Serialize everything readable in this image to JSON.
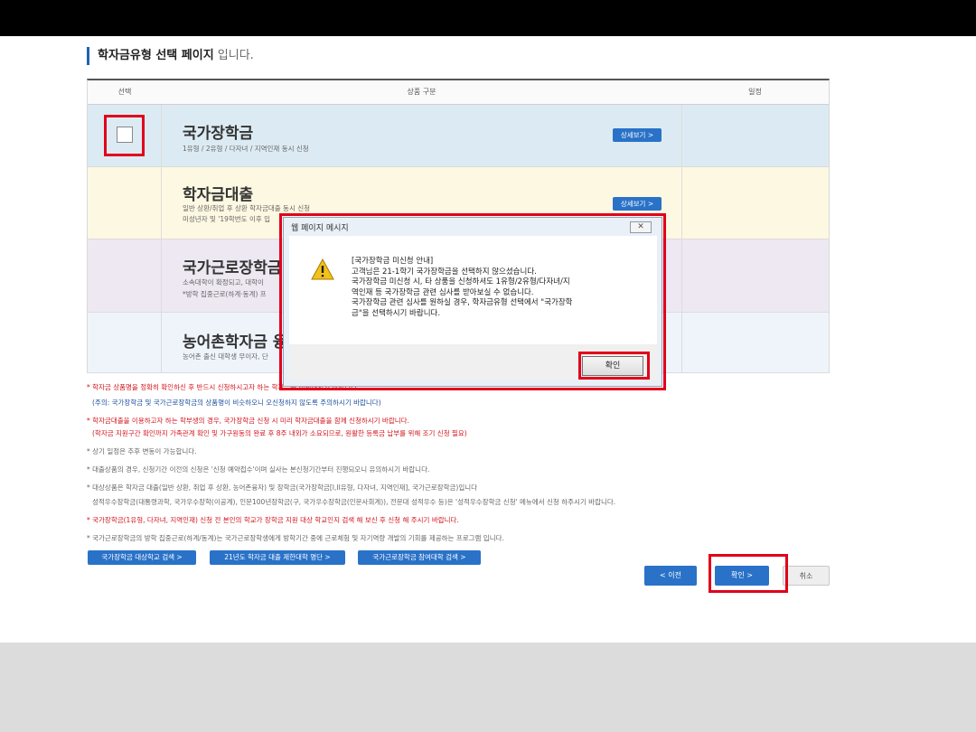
{
  "heading": {
    "bold": "학자금유형 선택 페이지",
    "rest": " 입니다."
  },
  "table": {
    "headers": [
      "선택",
      "상품 구분",
      "일정"
    ],
    "rows": [
      {
        "title": "국가장학금",
        "sub1": "1유형 / 2유형 / 다자녀 / 지역인재 동시 신청",
        "sub2": "",
        "detail": "상세보기 >",
        "bg": "#dcebf3"
      },
      {
        "title": "학자금대출",
        "sub1": "일반 상환/취업 후 상환 학자금대출 동시 신청",
        "sub2": "미성년자 및 '19학번도 이후 입",
        "detail": "상세보기 >",
        "bg": "#fdf8e2"
      },
      {
        "title": "국가근로장학금",
        "sub1": "소속대학이 확정되고, 대학이",
        "sub2": "*방학 집중근로(하계·동계) 프",
        "detail": "",
        "bg": "#ede8f1"
      },
      {
        "title": "농어촌학자금 융",
        "sub1": "농어촌 출신 대학생 무이자, 단",
        "sub2": "",
        "detail": "",
        "bg": "#eef4fa"
      }
    ]
  },
  "notes": {
    "n1": "* 학자금 상품명을 정확히 확인하신 후 반드시 신청하시고자 하는 학자금을 선택하시기 바랍니다.",
    "n1b": "(주의: 국가장학금 및 국가근로장학금의 상품명이 비슷하오니 오신청하지 않도록 주의하시기 바랍니다)",
    "n2": "* 학자금대출을 이용하고자 하는 학부생의 경우, 국가장학금 신청 시 미리 학자금대출을 함께 신청하시기 바랍니다.",
    "n2b": "(학자금 지원구간 확인까지 가족관계 확인 및 가구원동의 완료 후 8주 내외가 소요되므로, 원활한 등록금 납부를 위해 조기 신청 필요)",
    "n3": "* 상기 일정은 추후 변동이 가능합니다.",
    "n4": "* 대출상품의 경우, 신청기간 이전의 신청은 '신청 예약접수'이며 실사는 본신청기간부터 진행되오니 유의하시기 바랍니다.",
    "n5": "* 대상상품은 학자금 대출(일반 상환, 취업 후 상환, 농어촌융자) 및 장학금(국가장학금[I,II유형, 다자녀, 지역인재], 국가근로장학금)입니다",
    "n5b": "성적우수장학금(대통령과학, 국가우수장학(이공계), 인문100년장학금(구, 국가우수장학금(인문사회계)), 전문대 성적우수 등)은 '성적우수장학금 신청' 메뉴에서 신청 하주시기 바랍니다.",
    "n6": "* 국가장학금(1유형, 다자녀, 지역인재) 신청 전 본인의 학교가 장학금 지원 대상 학교인지 검색 해 보신 후 신청 해 주시기 바랍니다.",
    "n7": "* 국가근로장학금의 방학 집중근로(하계/동계)는 국가근로장학생에게 방학기간 중에 근로체험 및 자기역량 개발의 기회를 제공하는 프로그램 입니다."
  },
  "links": [
    "국가장학금 대상학교 검색 >",
    "21년도 학자금 대출 제한대학 명단 >",
    "국가근로장학금 참여대학 검색 >"
  ],
  "nav": {
    "prev": "< 이전",
    "confirm": "확인 >",
    "cancel": "취소"
  },
  "dialog": {
    "title": "웹 페이지 메시지",
    "close": "✕",
    "lines": [
      "[국가장학금 미신청 안내]",
      "고객님은 21-1학기 국가장학금을 선택하지 않으셨습니다.",
      "국가장학금 미신청 시, 타 상품을 신청하셔도 1유형/2유형/다자녀/지",
      "역인재 등 국가장학금 관련 심사를 받아보실 수 없습니다.",
      "국가장학금 관련 심사를 원하실 경우, 학자금유형 선택에서 \"국가장학",
      "금\"을 선택하시기 바랍니다."
    ],
    "ok": "확인"
  }
}
